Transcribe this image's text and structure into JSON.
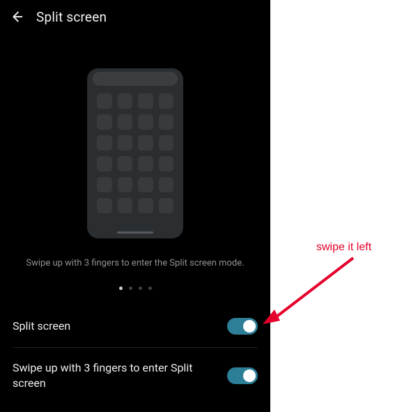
{
  "header": {
    "title": "Split screen"
  },
  "illustration": {
    "caption": "Swipe up with 3 fingers to enter the Split screen mode.",
    "pager": {
      "count": 4,
      "active_index": 0
    }
  },
  "settings": {
    "items": [
      {
        "label": "Split screen",
        "enabled": true
      },
      {
        "label": "Swipe up with 3 fingers to enter Split screen",
        "enabled": true
      }
    ]
  },
  "toggle_color_on": "#2d7f98",
  "annotation": {
    "text": "swipe it left",
    "color": "#e4002b"
  }
}
